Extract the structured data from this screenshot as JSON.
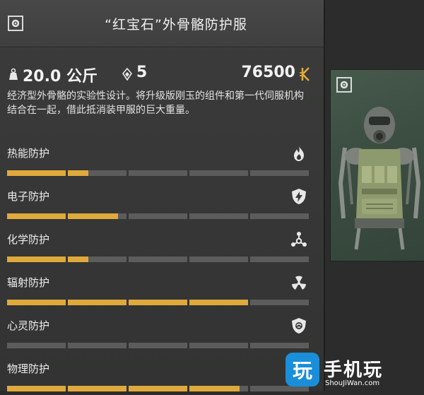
{
  "item": {
    "title": "“红宝石”外骨骼防护服",
    "weight": "20.0 公斤",
    "slots": "5",
    "price": "76500",
    "description": "经济型外骨骼的实验性设计。将升级版刚玉的组件和第一代伺服机构结合在一起，借此抵消装甲服的巨大重量。"
  },
  "protections": [
    {
      "label": "热能防护",
      "icon": "flame-icon",
      "value": 1.35
    },
    {
      "label": "电子防护",
      "icon": "lightning-shield-icon",
      "value": 1.85
    },
    {
      "label": "化学防护",
      "icon": "chemical-icon",
      "value": 1.35
    },
    {
      "label": "辐射防护",
      "icon": "radiation-icon",
      "value": 4.0
    },
    {
      "label": "心灵防护",
      "icon": "brain-shield-icon",
      "value": 0.0
    },
    {
      "label": "物理防护",
      "icon": "armor-icon",
      "value": 3.85
    }
  ],
  "colors": {
    "bar_fill": "#e0a93b",
    "bar_empty": "#5b5c5b"
  },
  "watermark": {
    "logo": "玩",
    "name": "手机玩",
    "url": "ShouJiWan.com"
  }
}
